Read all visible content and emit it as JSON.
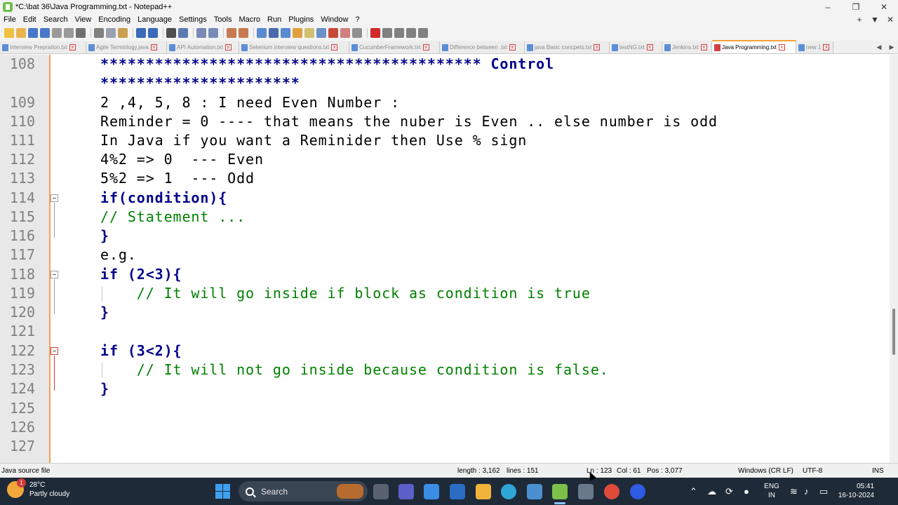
{
  "window": {
    "title": "*C:\\bat 36\\Java Programming.txt - Notepad++",
    "controls": [
      "–",
      "❐",
      "✕"
    ]
  },
  "menu": {
    "items": [
      "File",
      "Edit",
      "Search",
      "View",
      "Encoding",
      "Language",
      "Settings",
      "Tools",
      "Macro",
      "Run",
      "Plugins",
      "Window",
      "?"
    ],
    "right": [
      "+",
      "▼",
      "✕"
    ]
  },
  "tabs": [
    {
      "label": "Interview Prepration.txt",
      "active": false
    },
    {
      "label": "Agile Terminlogy.java",
      "active": false
    },
    {
      "label": "API Automation.txt",
      "active": false
    },
    {
      "label": "Selenium interview questions.txt",
      "active": false
    },
    {
      "label": "CucumberFramework.txt",
      "active": false
    },
    {
      "label": "Difference between .txt",
      "active": false
    },
    {
      "label": "java Basic concpets.txt",
      "active": false
    },
    {
      "label": "testNG.txt",
      "active": false
    },
    {
      "label": "Jenkins.txt",
      "active": false
    },
    {
      "label": "Java Programming.txt",
      "active": true
    },
    {
      "label": "new 1",
      "active": false
    }
  ],
  "tab_nav": [
    "◀",
    "▶",
    "✕"
  ],
  "editor": {
    "lines": [
      {
        "n": "108",
        "text": "****************************************** Control"
      },
      {
        "n": "",
        "text": "**********************"
      },
      {
        "n": "109",
        "text": "2 ,4, 5, 8 : I need Even Number :"
      },
      {
        "n": "110",
        "text": "Reminder = 0 ---- that means the nuber is Even .. else number is odd"
      },
      {
        "n": "111",
        "text": "In Java if you want a Reminider then Use % sign"
      },
      {
        "n": "112",
        "text": "4%2 => 0  --- Even"
      },
      {
        "n": "113",
        "text": "5%2 => 1  --- Odd"
      },
      {
        "n": "114",
        "text": "if(condition){"
      },
      {
        "n": "115",
        "text": "// Statement ..."
      },
      {
        "n": "116",
        "text": "}"
      },
      {
        "n": "117",
        "text": "e.g."
      },
      {
        "n": "118",
        "text": "if (2<3){"
      },
      {
        "n": "119",
        "text": "    // It will go inside if block as condition is true"
      },
      {
        "n": "120",
        "text": "}"
      },
      {
        "n": "121",
        "text": ""
      },
      {
        "n": "122",
        "text": "if (3<2){"
      },
      {
        "n": "123",
        "text": "    // It will not go inside because condition is false."
      },
      {
        "n": "124",
        "text": "}"
      },
      {
        "n": "125",
        "text": ""
      },
      {
        "n": "126",
        "text": ""
      },
      {
        "n": "127",
        "text": ""
      }
    ]
  },
  "status": {
    "file_type": "Java source file",
    "length": "length : 3,162",
    "lines": "lines : 151",
    "ln": "Ln : 123",
    "col": "Col : 61",
    "pos": "Pos : 3,077",
    "eol": "Windows (CR LF)",
    "encoding": "UTF-8",
    "mode": "INS"
  },
  "taskbar": {
    "weather_temp": "28°C",
    "weather_desc": "Partly cloudy",
    "weather_badge": "1",
    "search_label": "Search",
    "lang_line1": "ENG",
    "lang_line2": "IN",
    "time": "05:41",
    "date": "16-10-2024"
  },
  "colors": {
    "keyword": "#00008b",
    "number": "#ff8000",
    "comment": "#008000",
    "active_tab_accent": "#f8a03a"
  }
}
